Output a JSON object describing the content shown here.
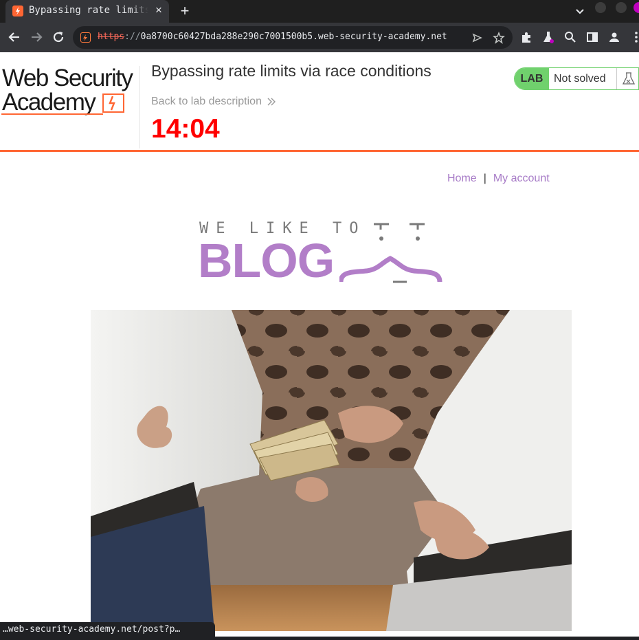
{
  "browser": {
    "tab": {
      "title": "Bypassing rate limits via race conditions",
      "close_icon": "×"
    },
    "new_tab_icon": "+",
    "url": {
      "scheme": "https",
      "separator": "://",
      "host": "0a8700c60427bda288e290c7001500b5.web-security-academy.net"
    },
    "status_bar_url": "…web-security-academy.net/post?p…"
  },
  "lab_header": {
    "logo_line1": "Web Security",
    "logo_line2": "Academy",
    "title": "Bypassing rate limits via race conditions",
    "back_link": "Back to lab description",
    "timer": "14:04",
    "badge": "LAB",
    "status": "Not solved"
  },
  "nav": {
    "home": "Home",
    "separator": "|",
    "my_account": "My account"
  },
  "blog_logo": {
    "tagline": "WE LIKE TO",
    "word": "BLOG"
  },
  "colors": {
    "brand_orange": "#ff6633",
    "lab_green": "#70d16d",
    "timer_red": "#ff0000",
    "link_purple": "#a77bc7",
    "blog_purple": "#b27ec8"
  }
}
